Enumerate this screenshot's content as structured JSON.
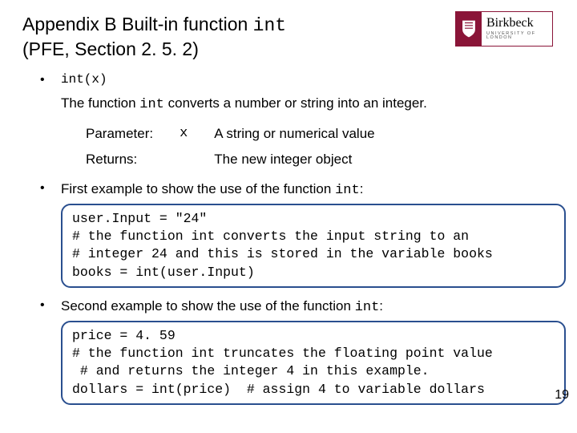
{
  "title": {
    "pre": "Appendix B Built-in function ",
    "code": "int",
    "post1": "(PFE, Section 2. 5. 2)"
  },
  "logo": {
    "name": "Birkbeck",
    "sub": "UNIVERSITY OF LONDON"
  },
  "sig": "int(x)",
  "desc": {
    "pre": "The function ",
    "code": "int",
    "post": " converts a number or string into an integer."
  },
  "params": {
    "p_label": "Parameter:",
    "p_name": "x",
    "p_desc": "A string or numerical value",
    "r_label": "Returns:",
    "r_desc": "The new integer object"
  },
  "ex1": {
    "lead_pre": "First example to show the use of the function ",
    "lead_code": "int",
    "lead_post": ":",
    "code": "user.Input = \"24\"\n# the function int converts the input string to an\n# integer 24 and this is stored in the variable books\nbooks = int(user.Input)"
  },
  "ex2": {
    "lead_pre": "Second example to show the use of the function ",
    "lead_code": "int",
    "lead_post": ":",
    "code": "price = 4. 59\n# the function int truncates the floating point value\n # and returns the integer 4 in this example.\ndollars = int(price)  # assign 4 to variable dollars"
  },
  "page": "19"
}
